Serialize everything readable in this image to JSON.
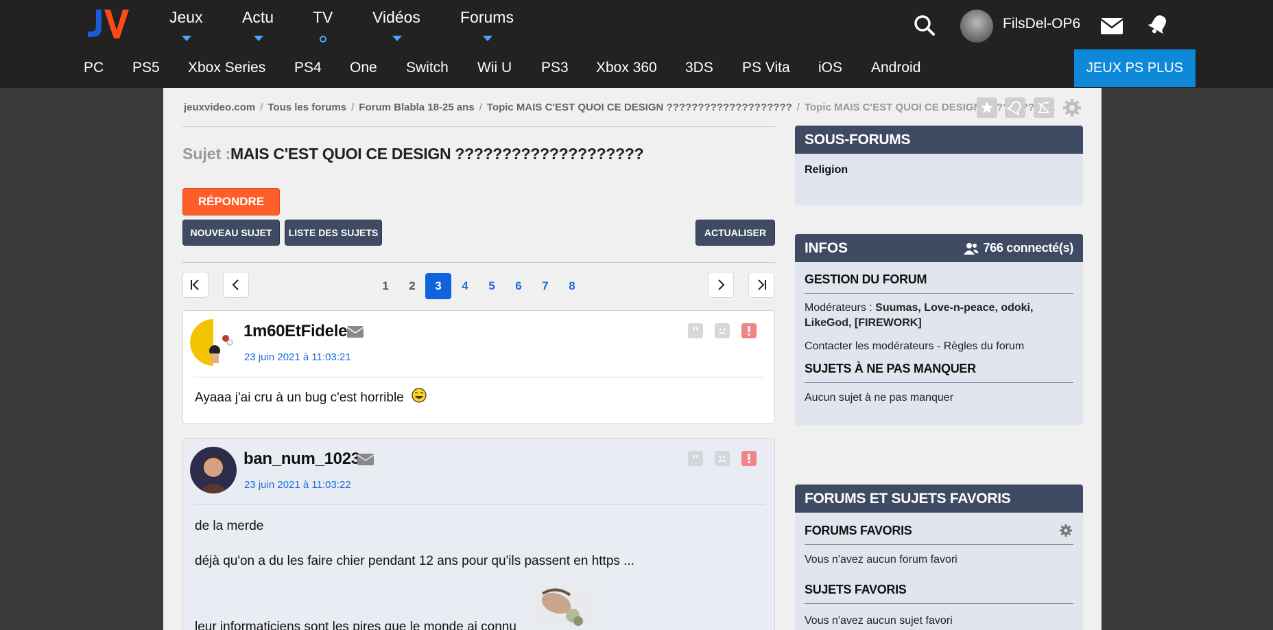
{
  "header": {
    "logo_text": "JV",
    "nav": [
      {
        "label": "Jeux",
        "indicator": "caret"
      },
      {
        "label": "Actu",
        "indicator": "caret"
      },
      {
        "label": "TV",
        "indicator": "dot"
      },
      {
        "label": "Vidéos",
        "indicator": "caret"
      },
      {
        "label": "Forums",
        "indicator": "caret"
      }
    ],
    "username": "FilsDel-OP6",
    "platforms": [
      "PC",
      "PS5",
      "Xbox Series",
      "PS4",
      "One",
      "Switch",
      "Wii U",
      "PS3",
      "Xbox 360",
      "3DS",
      "PS Vita",
      "iOS",
      "Android"
    ],
    "psplus_label": "JEUX PS PLUS"
  },
  "breadcrumb": [
    "jeuxvideo.com",
    "Tous les forums",
    "Forum Blabla 18-25 ans",
    "Topic MAIS C'EST QUOI CE DESIGN ????????????????????",
    "Topic MAIS C'EST QUOI CE DESIGN ??????????..."
  ],
  "topic": {
    "subject_label": "Sujet :",
    "subject_title": "MAIS C'EST QUOI CE DESIGN ????????????????????"
  },
  "buttons": {
    "reply": "RÉPONDRE",
    "new_topic": "NOUVEAU SUJET",
    "topic_list": "LISTE DES SUJETS",
    "refresh": "ACTUALISER"
  },
  "pagination": {
    "pages": [
      "1",
      "2",
      "3",
      "4",
      "5",
      "6",
      "7",
      "8"
    ],
    "current": "3"
  },
  "posts": [
    {
      "author": "1m60EtFidele",
      "date": "23 juin 2021 à 11:03:21",
      "lines": [
        "Ayaaa j'ai cru à un bug c'est horrible"
      ]
    },
    {
      "author": "ban_num_1023",
      "date": "23 juin 2021 à 11:03:22",
      "lines": [
        "de la merde",
        "déjà qu'on a du les faire chier pendant 12 ans pour qu'ils passent en https ...",
        "leur informaticiens sont les pires que le monde ai connu"
      ]
    }
  ],
  "sidebar": {
    "sous_forums": {
      "title": "SOUS-FORUMS",
      "items": [
        "Religion"
      ]
    },
    "infos": {
      "title": "INFOS",
      "connected": "766 connecté(s)",
      "gestion_title": "GESTION DU FORUM",
      "moderators_label": "Modérateurs :",
      "moderators": "Suumas, Love-n-peace, odoki,",
      "moderators_line2": "LikeGod, [FIREWORK]",
      "contact": "Contacter les modérateurs - Règles du forum",
      "ne_pas_manquer_title": "SUJETS À NE PAS MANQUER",
      "ne_pas_manquer_text": "Aucun sujet à ne pas manquer"
    },
    "favoris": {
      "title": "FORUMS ET SUJETS FAVORIS",
      "forums_title": "FORUMS FAVORIS",
      "forums_text": "Vous n'avez aucun forum favori",
      "sujets_title": "SUJETS FAVORIS",
      "sujets_text": "Vous n'avez aucun sujet favori"
    }
  },
  "colors": {
    "accent_orange": "#ff5e2b",
    "accent_blue": "#0e88d8",
    "dark_blue": "#3f4a63",
    "link_blue": "#1a6bd9"
  }
}
